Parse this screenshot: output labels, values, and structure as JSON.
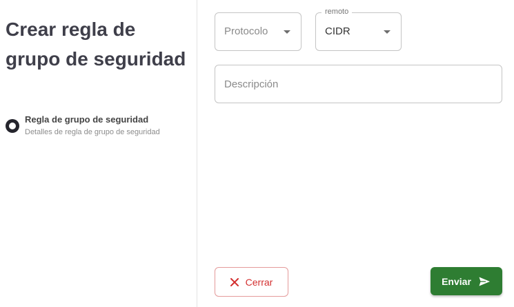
{
  "page": {
    "title": "Crear regla de grupo de seguridad"
  },
  "stepper": {
    "step_title": "Regla de grupo de seguridad",
    "step_subtitle": "Detalles de regla de grupo de seguridad"
  },
  "form": {
    "protocol": {
      "placeholder": "Protocolo",
      "value": ""
    },
    "remote": {
      "label": "remoto",
      "value": "CIDR"
    },
    "description": {
      "placeholder": "Descripción",
      "value": ""
    }
  },
  "actions": {
    "close_label": "Cerrar",
    "submit_label": "Enviar"
  },
  "colors": {
    "close": "#d32f2f",
    "submit": "#2e7d32",
    "title": "#3f3f4a"
  }
}
